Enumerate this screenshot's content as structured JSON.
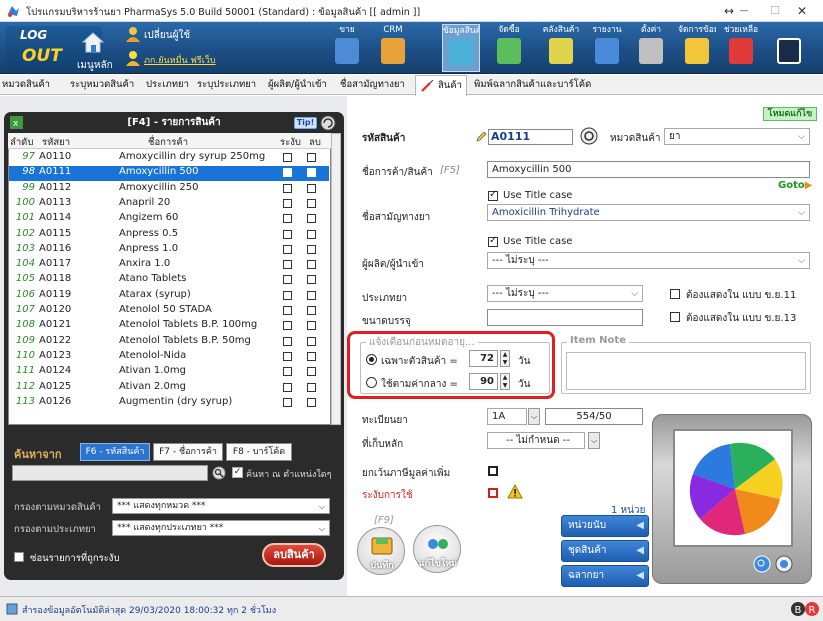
{
  "window": {
    "title": "โปรแกรมบริหารร้านยา PharmaSys 5.0 Build 50001 (Standard) : ข้อมูลสินค้า [[ admin ]]",
    "min": "—",
    "max": "☐",
    "close": "✕",
    "restore": "↔"
  },
  "header": {
    "logout_top": "LOG",
    "logout_bottom": "OUT",
    "main_menu": "เมนูหลัก",
    "switch_user": "เปลี่ยนผู้ใช้",
    "user_name": "ภก.ยันหมื่น ฟรีเว็บ"
  },
  "toolbar": [
    {
      "label": "ขาย",
      "icon": "sale-icon"
    },
    {
      "label": "CRM",
      "icon": "crm-icon"
    },
    {
      "label": "ข้อมูลสินค้า",
      "icon": "product-data-icon",
      "active": true
    },
    {
      "label": "จัดซื้อ",
      "icon": "purchase-icon"
    },
    {
      "label": "คลังสินค้า",
      "icon": "warehouse-icon"
    },
    {
      "label": "รายงาน",
      "icon": "report-icon"
    },
    {
      "label": "ตั้งค่า",
      "icon": "settings-icon"
    },
    {
      "label": "จัดการข้อมูล",
      "icon": "manage-data-icon"
    },
    {
      "label": "ช่วยเหลือ",
      "icon": "help-icon"
    },
    {
      "label": "",
      "icon": "exit-icon"
    }
  ],
  "tabs": [
    "หมวดสินค้า",
    "ระบุหมวดสินค้า",
    "ประเภทยา",
    "ระบุประเภทยา",
    "ผู้ผลิต/ผู้นำเข้า",
    "ชื่อสามัญทางยา",
    "สินค้า",
    "พิมพ์ฉลากสินค้าและบาร์โค้ด"
  ],
  "product_list": {
    "title": "[F4] - รายการสินค้า",
    "tip": "Tip!",
    "columns": [
      "ลำดับ",
      "รหัสยา",
      "ชื่อการค้า",
      "ระงับ",
      "ลบ"
    ],
    "rows": [
      {
        "no": "97",
        "code": "A0110",
        "name": "Amoxycillin dry syrup 250mg"
      },
      {
        "no": "98",
        "code": "A0111",
        "name": "Amoxycillin 500",
        "selected": true
      },
      {
        "no": "99",
        "code": "A0112",
        "name": "Amoxycillin 250"
      },
      {
        "no": "100",
        "code": "A0113",
        "name": "Anapril 20"
      },
      {
        "no": "101",
        "code": "A0114",
        "name": "Angizem 60"
      },
      {
        "no": "102",
        "code": "A0115",
        "name": "Anpress 0.5"
      },
      {
        "no": "103",
        "code": "A0116",
        "name": "Anpress 1.0"
      },
      {
        "no": "104",
        "code": "A0117",
        "name": "Anxira 1.0"
      },
      {
        "no": "105",
        "code": "A0118",
        "name": "Atano Tablets"
      },
      {
        "no": "106",
        "code": "A0119",
        "name": "Atarax (syrup)"
      },
      {
        "no": "107",
        "code": "A0120",
        "name": "Atenolol 50 STADA"
      },
      {
        "no": "108",
        "code": "A0121",
        "name": "Atenolol Tablets B.P. 100mg"
      },
      {
        "no": "109",
        "code": "A0122",
        "name": "Atenolol Tablets B.P. 50mg"
      },
      {
        "no": "110",
        "code": "A0123",
        "name": "Atenolol-Nida"
      },
      {
        "no": "111",
        "code": "A0124",
        "name": "Ativan 1.0mg"
      },
      {
        "no": "112",
        "code": "A0125",
        "name": "Ativan 2.0mg"
      },
      {
        "no": "113",
        "code": "A0126",
        "name": "Augmentin (dry syrup)"
      }
    ]
  },
  "search": {
    "label": "ค้นหาจาก",
    "by_code": "F6 - รหัสสินค้า",
    "by_name": "F7 - ชื่อการค้า",
    "by_barcode": "F8 - บาร์โค้ด",
    "anywhere": "ค้นหา ณ ตำแหน่งใดๆ",
    "filter_category_label": "กรองตามหมวดสินค้า",
    "filter_category_value": "*** แสดงทุกหมวด ***",
    "filter_type_label": "กรองตามประเภทยา",
    "filter_type_value": "*** แสดงทุกประเภทยา ***",
    "hide_suspended": "ซ่อนรายการที่ถูกระงับ",
    "delete_button": "ลบสินค้า"
  },
  "form": {
    "mode": "โหมดแก้ไข",
    "code_label": "รหัสสินค้า",
    "code_value": "A0111",
    "category_label": "หมวดสินค้า",
    "category_value": "ยา",
    "trade_name_label": "ชื่อการค้า/สินค้า",
    "trade_name_hotkey": "[F5]",
    "trade_name_value": "Amoxycillin 500",
    "use_title_case": "Use Title case",
    "goto": "Goto",
    "generic_label": "ชื่อสามัญทางยา",
    "generic_value": "Amoxicillin Trihydrate",
    "use_title_case2": "Use Title case",
    "manufacturer_label": "ผู้ผลิต/ผู้นำเข้า",
    "manufacturer_value": "--- ไม่ระบุ ---",
    "drug_type_label": "ประเภทยา",
    "drug_type_value": "--- ไม่ระบุ ---",
    "must_show_11": "ต้องแสดงใน แบบ ข.ย.11",
    "package_label": "ขนาดบรรจุ",
    "must_show_13": "ต้องแสดงใน แบบ ข.ย.13",
    "expiry_group": "แจ้งเตือนก่อนหมดอายุ...",
    "expiry_specific": "เฉพาะตัวสินค้า =",
    "expiry_specific_value": "72",
    "expiry_central": "ใช้ตามค่ากลาง =",
    "expiry_central_value": "90",
    "days": "วัน",
    "days2": "วัน",
    "item_note": "Item Note",
    "reg_label": "ทะเบียนยา",
    "reg_prefix": "1A",
    "reg_value": "554/50",
    "storage_label": "ที่เก็บหลัก",
    "storage_value": "-- ไม่กำหนด --",
    "vat_exempt": "ยกเว้นภาษีมูลค่าเพิ่ม",
    "suspend": "ระงับการใช้",
    "f9": "[F9]",
    "save": "บันทึก",
    "cancel": "แก้ไขใหม่",
    "unit_count": "1 หน่วย",
    "unit_button": "หน่วยนับ",
    "set_button": "ชุดสินค้า",
    "label_button": "ฉลากยา"
  },
  "status": {
    "text": "สำรองข้อมูลอัตโนมัติล่าสุด  29/03/2020 18:00:32  ทุก 2 ชั่วโมง"
  },
  "colors": {
    "accent": "#1a73d6",
    "toolbar": "#1d4f86",
    "highlight": "#e02020",
    "mode": "#1a8a1a"
  }
}
